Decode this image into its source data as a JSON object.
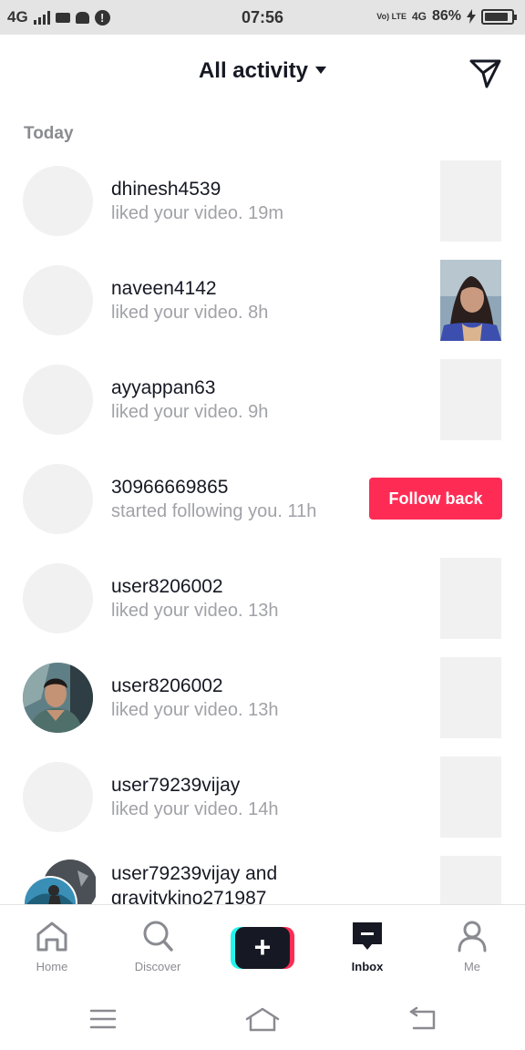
{
  "status_bar": {
    "network": "4G",
    "time": "07:56",
    "volte": "Vo) LTE",
    "network2": "4G",
    "battery": "86%"
  },
  "header": {
    "title": "All activity",
    "send_icon": "send-icon"
  },
  "section": {
    "label": "Today"
  },
  "notifications": [
    {
      "username": "dhinesh4539",
      "action": "liked your video.",
      "time": "19m",
      "avatar": "placeholder",
      "thumbnail": "placeholder"
    },
    {
      "username": "naveen4142",
      "action": "liked your video.",
      "time": "8h",
      "avatar": "placeholder",
      "thumbnail": "video-frame"
    },
    {
      "username": "ayyappan63",
      "action": "liked your video.",
      "time": "9h",
      "avatar": "placeholder",
      "thumbnail": "placeholder"
    },
    {
      "username": "30966669865",
      "action": "started following you.",
      "time": "11h",
      "avatar": "placeholder",
      "button": "Follow back"
    },
    {
      "username": "user8206002",
      "action": "liked your video.",
      "time": "13h",
      "avatar": "placeholder",
      "thumbnail": "placeholder"
    },
    {
      "username": "user8206002",
      "action": "liked your video.",
      "time": "13h",
      "avatar": "photo",
      "thumbnail": "placeholder"
    },
    {
      "username": "user79239vijay",
      "action": "liked your video.",
      "time": "14h",
      "avatar": "placeholder",
      "thumbnail": "placeholder"
    },
    {
      "username": "user79239vijay",
      "conjunction": "and",
      "username2": "gravitykino271987",
      "avatar": "group-photo",
      "thumbnail": "placeholder"
    }
  ],
  "tabbar": {
    "home": "Home",
    "discover": "Discover",
    "create_icon": "plus-icon",
    "inbox": "Inbox",
    "me": "Me"
  },
  "colors": {
    "accent": "#fe2c55",
    "cyan": "#25f4ee",
    "text": "#161823",
    "secondary": "#a1a2a7",
    "placeholder": "#f1f1f2"
  }
}
